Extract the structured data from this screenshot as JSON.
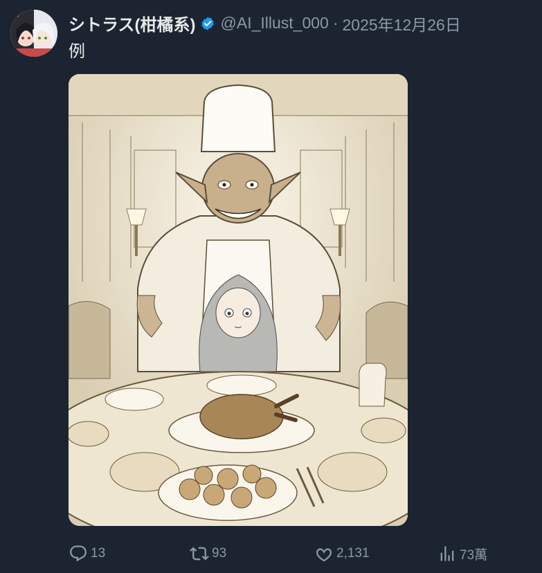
{
  "post": {
    "display_name": "シトラス(柑橘系)",
    "handle": "@AI_Illust_000",
    "separator": "·",
    "date": "2025年12月26日",
    "text": "例"
  },
  "media": {
    "kind": "illustration",
    "description": "Sepia manga-style illustration of a grinning goblin chef in a tall toque standing behind a frightened silver-haired girl at a banquet table with roast turkey, bowls of soup and pastries"
  },
  "actions": {
    "reply": {
      "count": "13",
      "icon": "reply-icon"
    },
    "repost": {
      "count": "93",
      "icon": "repost-icon"
    },
    "like": {
      "count": "2,131",
      "icon": "heart-icon"
    },
    "views": {
      "count": "73萬",
      "icon": "views-icon"
    }
  },
  "colors": {
    "background": "#1c2431",
    "text_primary": "#e7e9ea",
    "text_secondary": "#8b98a5",
    "verified": "#1d9bf0"
  }
}
